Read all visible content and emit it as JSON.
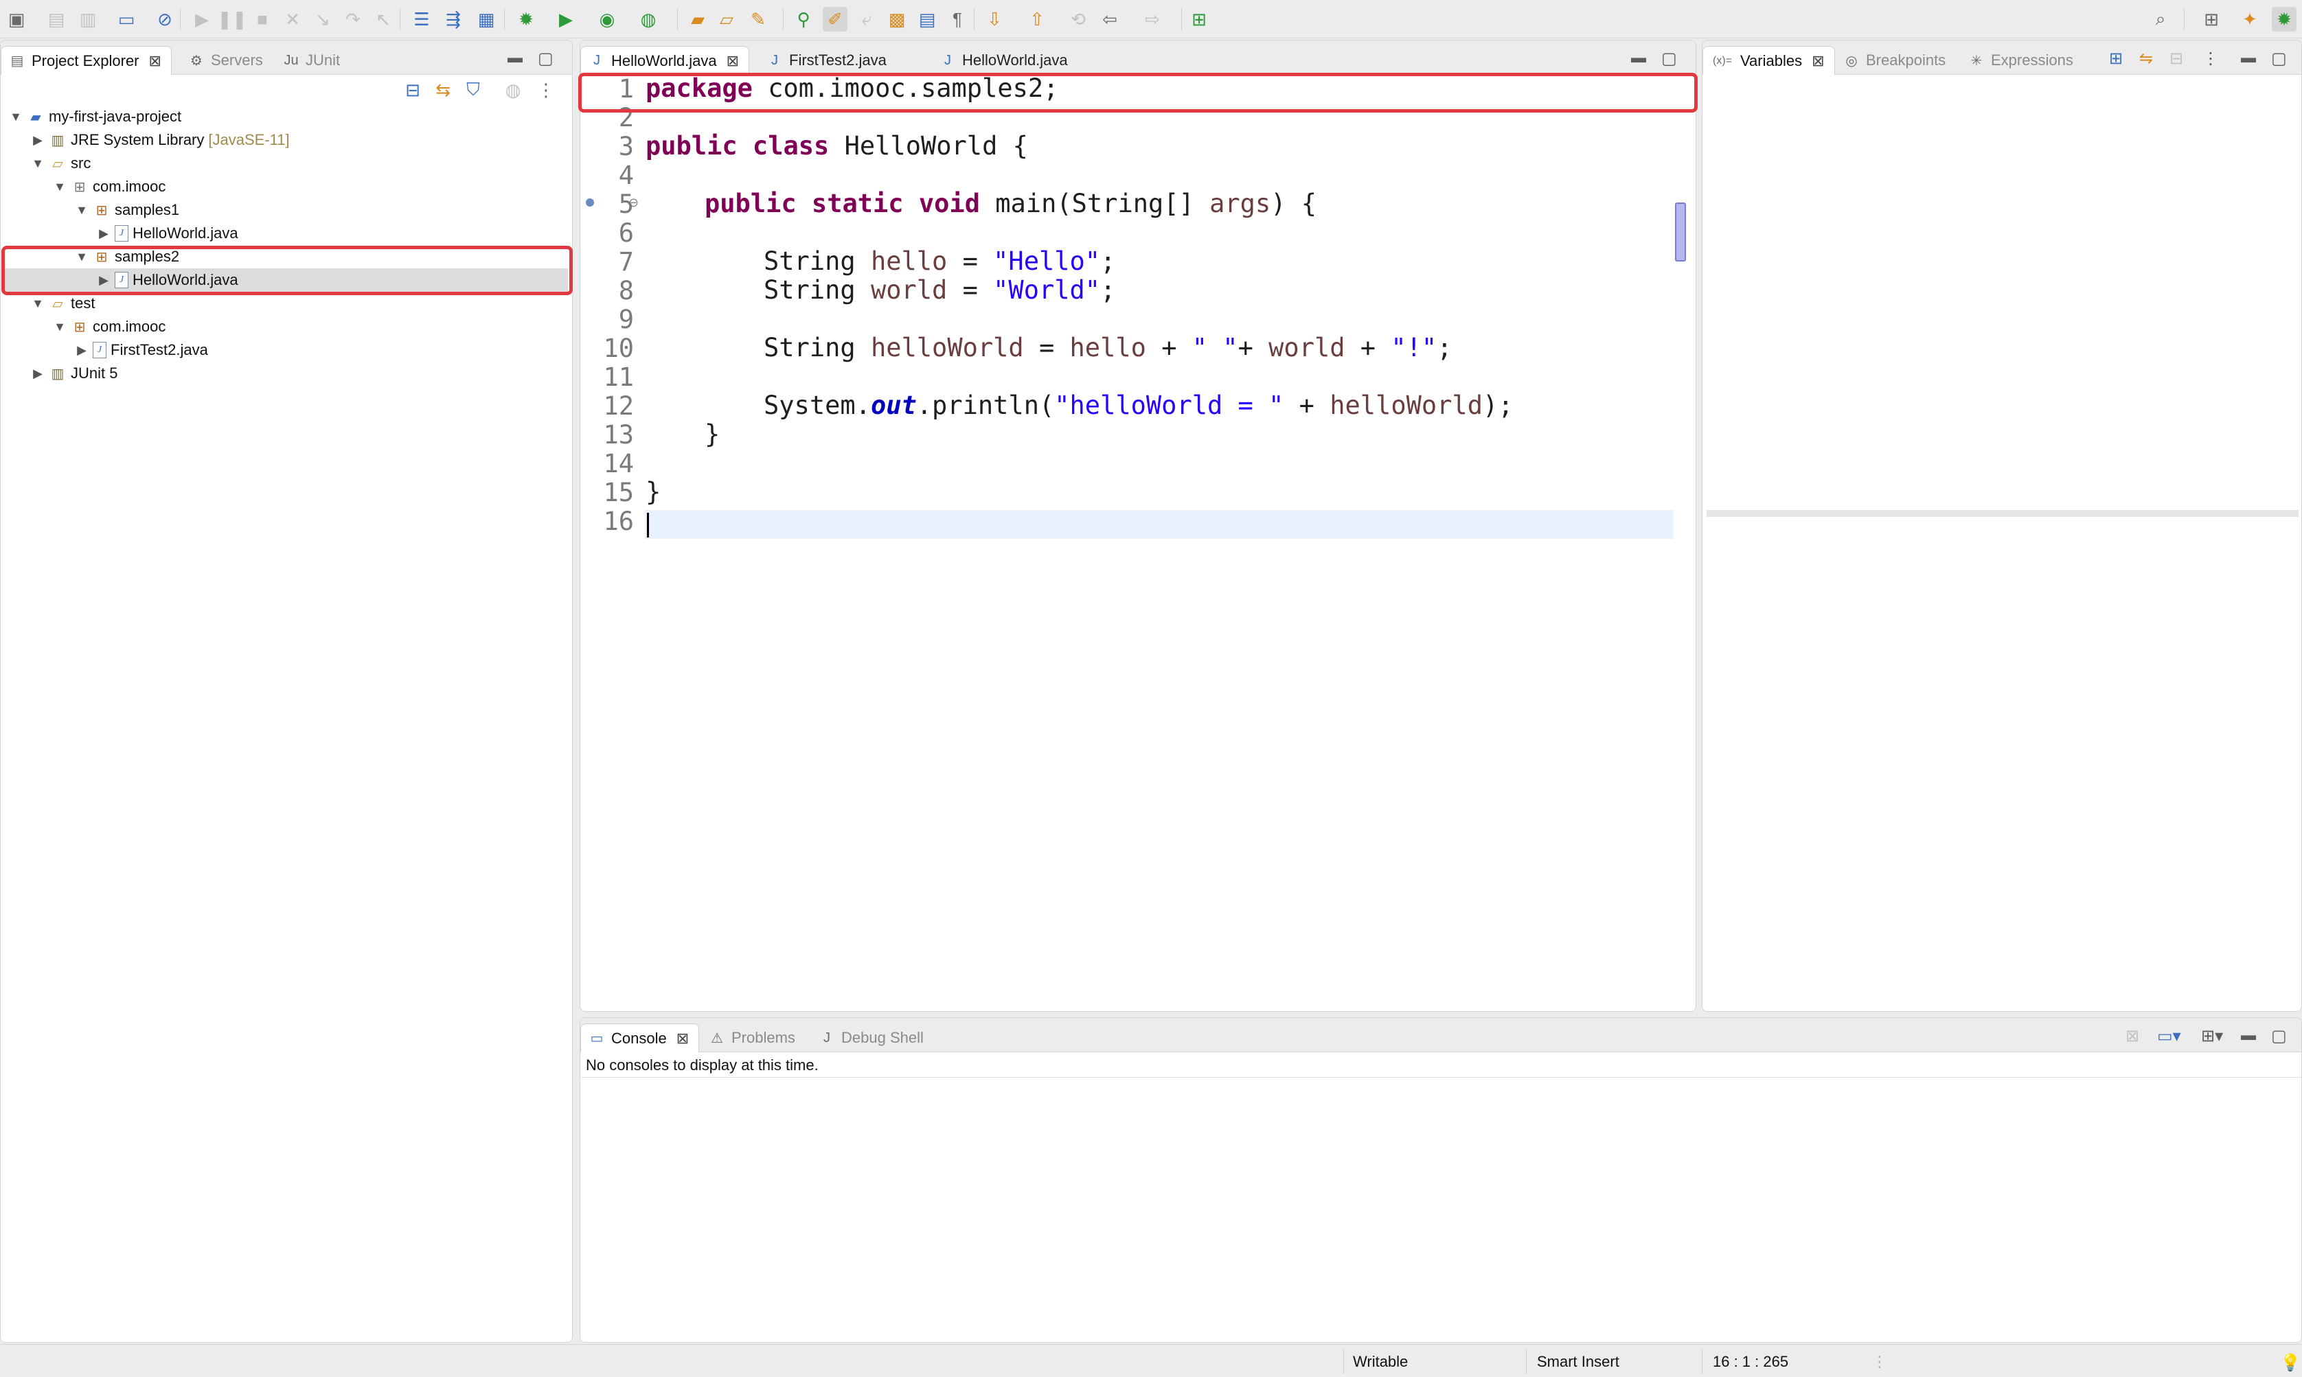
{
  "toolbar": {
    "icons": [
      "new-wizard",
      "save",
      "save-all",
      "print",
      "skip-breakpoints",
      "resume",
      "suspend",
      "terminate",
      "disconnect",
      "step-into",
      "step-over",
      "step-return",
      "drop-to-frame",
      "use-step-filters",
      "debug",
      "run",
      "coverage",
      "external-tools",
      "new-java-project",
      "new-package",
      "new-class",
      "open-type",
      "search",
      "toggle-mark-occurrences",
      "toggle-word-wrap",
      "block-selection",
      "show-whitespace",
      "next-annotation",
      "previous-annotation",
      "last-edit-location",
      "back",
      "forward",
      "pin-editor",
      "search-icon",
      "open-perspective",
      "java-perspective",
      "debug-perspective"
    ]
  },
  "project_explorer": {
    "tabs": [
      {
        "label": "Project Explorer",
        "active": true
      },
      {
        "label": "Servers",
        "active": false
      },
      {
        "label": "JUnit",
        "active": false
      }
    ],
    "tree": [
      {
        "label": "my-first-java-project",
        "decor": "",
        "icon": "project",
        "expanded": true,
        "depth": 0
      },
      {
        "label": "JRE System Library",
        "decor": "[JavaSE-11]",
        "icon": "library",
        "expanded": false,
        "depth": 1
      },
      {
        "label": "src",
        "decor": "",
        "icon": "source-folder",
        "expanded": true,
        "depth": 1
      },
      {
        "label": "com.imooc",
        "decor": "",
        "icon": "package",
        "expanded": true,
        "depth": 2
      },
      {
        "label": "samples1",
        "decor": "",
        "icon": "package",
        "expanded": true,
        "depth": 3
      },
      {
        "label": "HelloWorld.java",
        "decor": "",
        "icon": "java-file",
        "expanded": false,
        "depth": 4
      },
      {
        "label": "samples2",
        "decor": "",
        "icon": "package",
        "expanded": true,
        "depth": 3
      },
      {
        "label": "HelloWorld.java",
        "decor": "",
        "icon": "java-file",
        "expanded": false,
        "depth": 4,
        "selected": true
      },
      {
        "label": "test",
        "decor": "",
        "icon": "source-folder",
        "expanded": true,
        "depth": 1
      },
      {
        "label": "com.imooc",
        "decor": "",
        "icon": "package",
        "expanded": true,
        "depth": 2
      },
      {
        "label": "FirstTest2.java",
        "decor": "",
        "icon": "java-file",
        "expanded": false,
        "depth": 3
      },
      {
        "label": "JUnit 5",
        "decor": "",
        "icon": "library",
        "expanded": false,
        "depth": 1
      }
    ]
  },
  "editor": {
    "tabs": [
      {
        "label": "HelloWorld.java",
        "active": true
      },
      {
        "label": "FirstTest2.java",
        "active": false
      },
      {
        "label": "HelloWorld.java",
        "active": false
      }
    ],
    "line_numbers": [
      "1",
      "2",
      "3",
      "4",
      "5",
      "6",
      "7",
      "8",
      "9",
      "10",
      "11",
      "12",
      "13",
      "14",
      "15",
      "16"
    ],
    "lines": {
      "l1": {
        "kw": "package",
        "rest": " com.imooc.samples2;"
      },
      "l3": {
        "kw": "public class",
        "rest": " HelloWorld {"
      },
      "l5": {
        "kw": "public static void",
        "rest": " main(String[] ",
        "var": "args",
        "tail": ") {"
      },
      "l7": {
        "a": "String ",
        "var": "hello",
        "b": " = ",
        "str": "\"Hello\"",
        "c": ";"
      },
      "l8": {
        "a": "String ",
        "var": "world",
        "b": " = ",
        "str": "\"World\"",
        "c": ";"
      },
      "l10": {
        "a": "String ",
        "var": "helloWorld",
        "b": " = ",
        "v2": "hello",
        "c": " + ",
        "s1": "\" \"",
        "d": "+ ",
        "v3": "world",
        "e": " + ",
        "s2": "\"!\"",
        "f": ";"
      },
      "l12": {
        "a": "System.",
        "fld": "out",
        "b": ".println(",
        "str": "\"helloWorld = \"",
        "c": " + ",
        "var": "helloWorld",
        "d": ");"
      },
      "l13": "}",
      "l15": "}"
    }
  },
  "variables_view": {
    "tabs": [
      {
        "label": "Variables",
        "active": true
      },
      {
        "label": "Breakpoints",
        "active": false
      },
      {
        "label": "Expressions",
        "active": false
      }
    ]
  },
  "console_view": {
    "tabs": [
      {
        "label": "Console",
        "active": true
      },
      {
        "label": "Problems",
        "active": false
      },
      {
        "label": "Debug Shell",
        "active": false
      }
    ],
    "message": "No consoles to display at this time."
  },
  "statusbar": {
    "writable": "Writable",
    "insert_mode": "Smart Insert",
    "position": "16 : 1 : 265"
  },
  "colors": {
    "keyword": "#7f0055",
    "string": "#2a00ff",
    "local_var": "#6a3e3e",
    "static_field": "#0000c0",
    "highlight_box": "#e1393f"
  }
}
